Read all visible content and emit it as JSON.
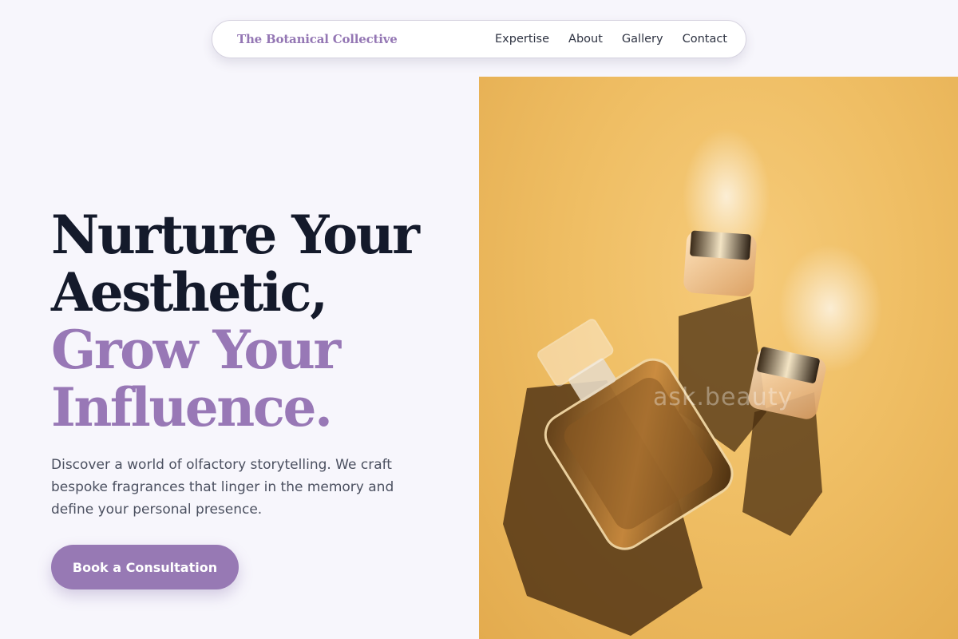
{
  "nav": {
    "brand": "The Botanical Collective",
    "links": [
      "Expertise",
      "About",
      "Gallery",
      "Contact"
    ]
  },
  "hero": {
    "headline_lines": [
      "Nurture Your",
      "Aesthetic,",
      "Grow Your",
      "Influence."
    ],
    "description": "Discover a world of olfactory storytelling. We craft bespoke fragrances that linger in the memory and define your personal presence.",
    "cta_label": "Book a Consultation"
  },
  "image": {
    "watermark": "ask.beauty",
    "subject": "perfume bottle and two cosmetic jars on golden background"
  },
  "colors": {
    "accent": "#9779b4",
    "heading": "#141a2b",
    "background": "#f7f6fc",
    "photo_bg": "#efbe64"
  }
}
